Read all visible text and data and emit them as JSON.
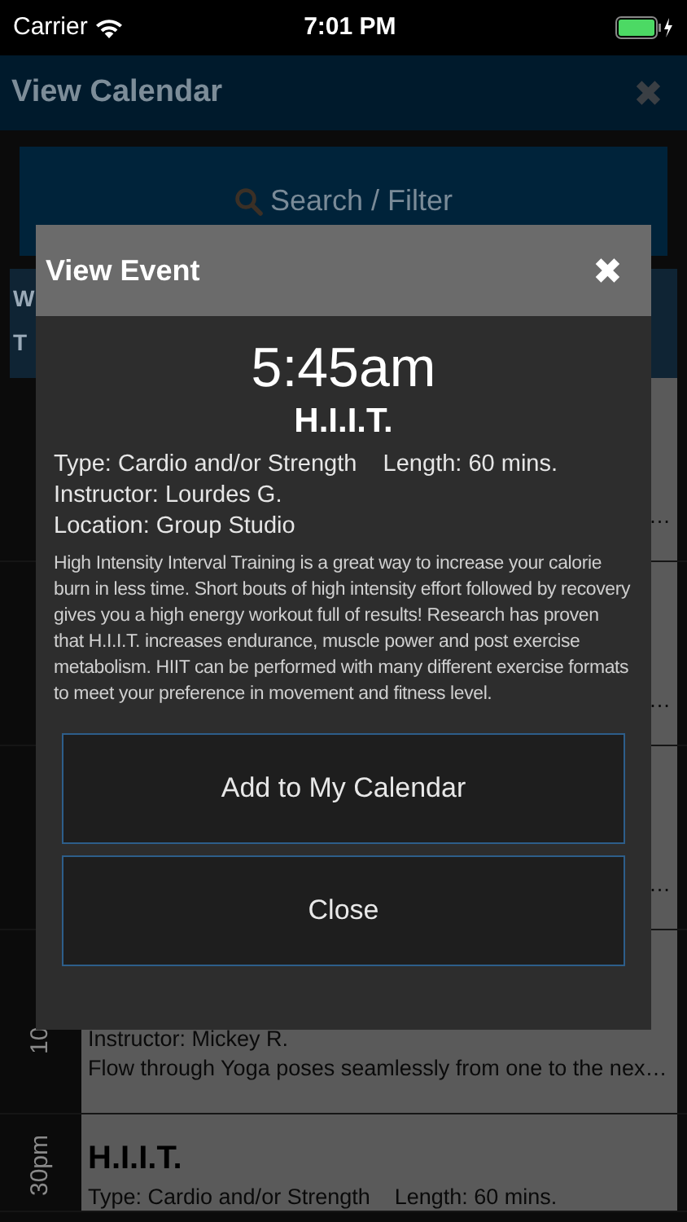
{
  "status_bar": {
    "carrier": "Carrier",
    "time": "7:01 PM"
  },
  "header": {
    "title": "View Calendar",
    "close_icon": "✖"
  },
  "search": {
    "placeholder": "Search / Filter"
  },
  "day_tabs": [
    "W",
    "T"
  ],
  "list": [
    {
      "lines": [
        "…"
      ]
    },
    {
      "lines": [
        "…"
      ]
    },
    {
      "lines": [
        "…"
      ]
    },
    {
      "time": "10",
      "lines": [
        "Instructor: Mickey R.",
        "Flow through Yoga poses seamlessly from one to the nex…"
      ]
    },
    {
      "time": "30pm",
      "title": "H.I.I.T.",
      "lines": [
        "Type: Cardio and/or Strength    Length: 60 mins."
      ]
    }
  ],
  "modal": {
    "title": "View Event",
    "close_icon": "✖",
    "time": "5:45am",
    "name": "H.I.I.T.",
    "details": [
      "Type: Cardio and/or Strength    Length: 60 mins.",
      "Instructor: Lourdes G.",
      "Location: Group Studio"
    ],
    "description": "High Intensity Interval Training is a great way to increase your calorie burn in less time. Short bouts of high intensity effort followed by recovery gives you a high energy workout full of results!  Research has proven that H.I.I.T. increases endurance, muscle power and post exercise metabolism. HIIT can be performed with many different exercise formats to meet your preference in movement and fitness level.",
    "buttons": [
      "Add to My Calendar",
      "Close"
    ]
  }
}
